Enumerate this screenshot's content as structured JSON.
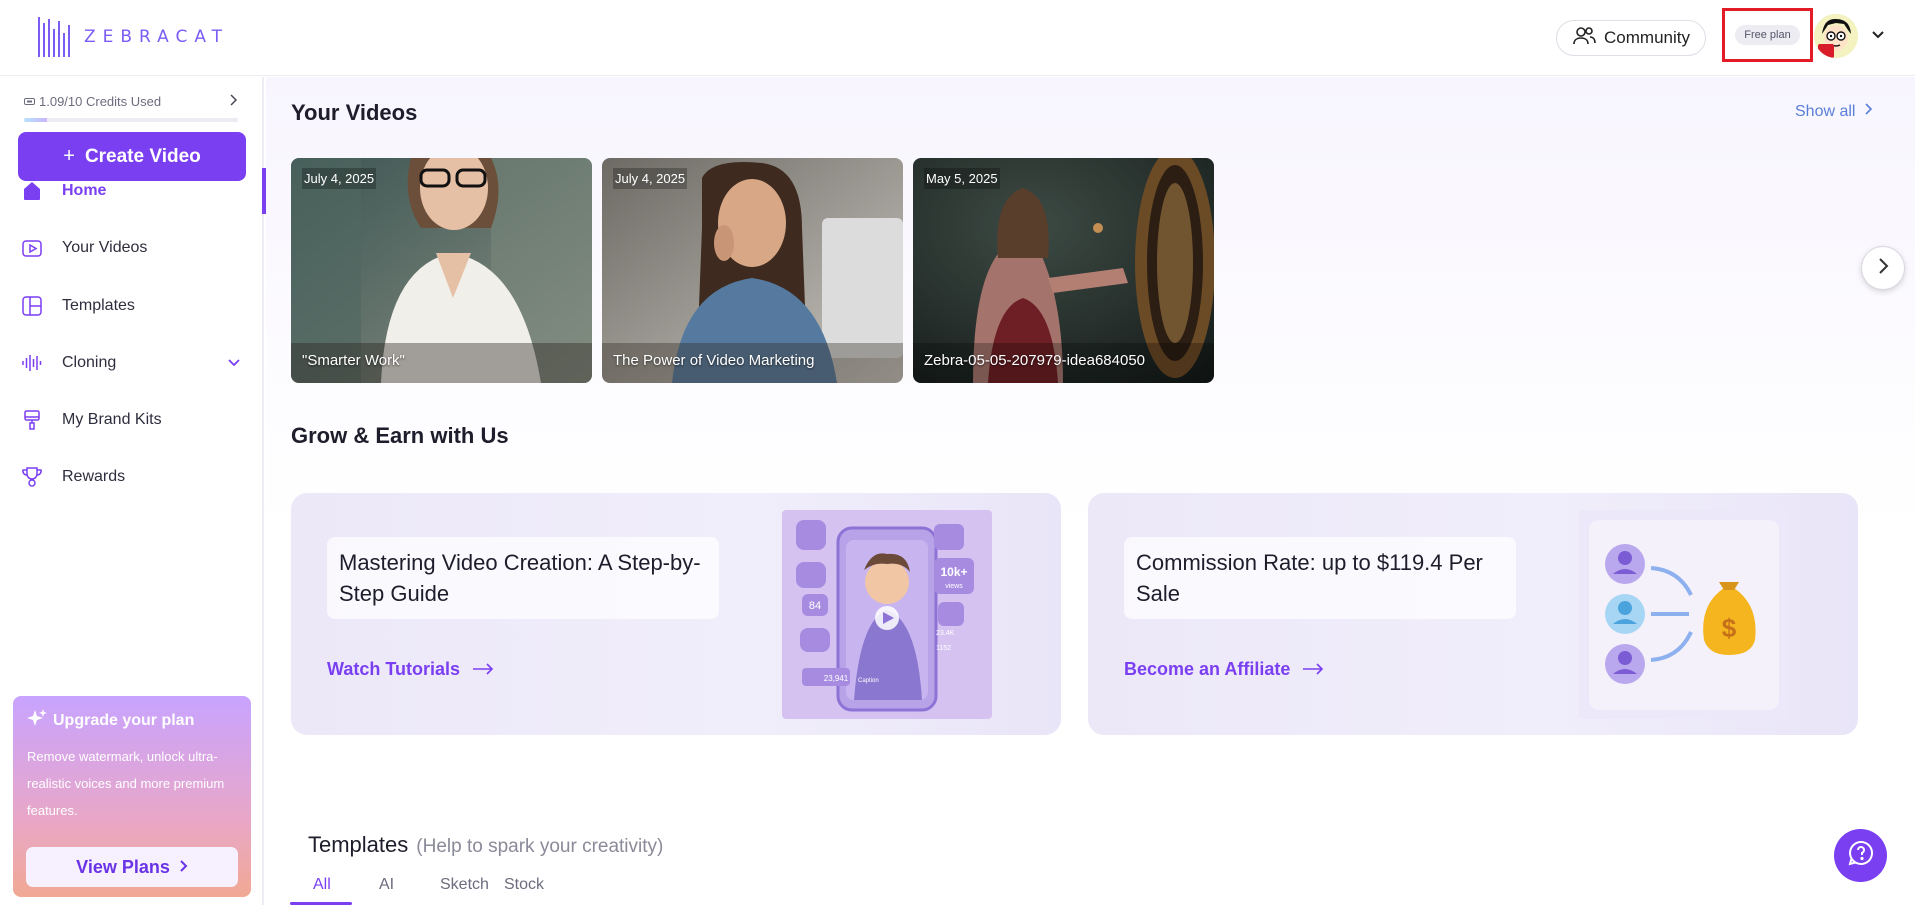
{
  "app": {
    "logo_text": "ZEBRACAT",
    "accent": "#7b3ff2"
  },
  "header": {
    "community_label": "Community",
    "plan_badge": "Free plan"
  },
  "sidebar": {
    "credits_label": "1.09/10 Credits Used",
    "credits_fraction": 0.109,
    "create_video_label": "Create Video",
    "items": [
      {
        "label": "Home",
        "icon": "home-icon",
        "active": true
      },
      {
        "label": "Your Videos",
        "icon": "video-play-icon",
        "active": false
      },
      {
        "label": "Templates",
        "icon": "templates-icon",
        "active": false
      },
      {
        "label": "Cloning",
        "icon": "waveform-icon",
        "active": false,
        "expandable": true
      },
      {
        "label": "My Brand Kits",
        "icon": "brush-icon",
        "active": false
      },
      {
        "label": "Rewards",
        "icon": "trophy-icon",
        "active": false
      }
    ],
    "upgrade": {
      "title": "Upgrade your plan",
      "description": "Remove watermark, unlock ultra-realistic voices and more premium features.",
      "button_label": "View Plans"
    }
  },
  "main": {
    "your_videos": {
      "title": "Your Videos",
      "show_all_label": "Show all",
      "videos": [
        {
          "date": "July 4, 2025",
          "title": "\"Smarter Work\""
        },
        {
          "date": "July 4, 2025",
          "title": "The Power of Video Marketing"
        },
        {
          "date": "May 5, 2025",
          "title": "Zebra-05-05-207979-idea684050"
        }
      ]
    },
    "grow": {
      "title": "Grow & Earn with Us",
      "cards": [
        {
          "heading": "Mastering Video Creation: A Step-by-Step Guide",
          "link": "Watch Tutorials",
          "stat_views": "10k+",
          "stat_views_label": "views",
          "stat_count": "84",
          "stat_yt": "23,941",
          "stat_likes": "23.4K",
          "stat_comments": "1152",
          "caption_label": "Caption"
        },
        {
          "heading": "Commission Rate: up to $119.4 Per Sale",
          "link": "Become an Affiliate"
        }
      ]
    },
    "templates": {
      "title": "Templates",
      "subtitle": "(Help to spark your creativity)",
      "tabs": [
        "All",
        "AI",
        "Sketch",
        "Stock"
      ]
    }
  }
}
